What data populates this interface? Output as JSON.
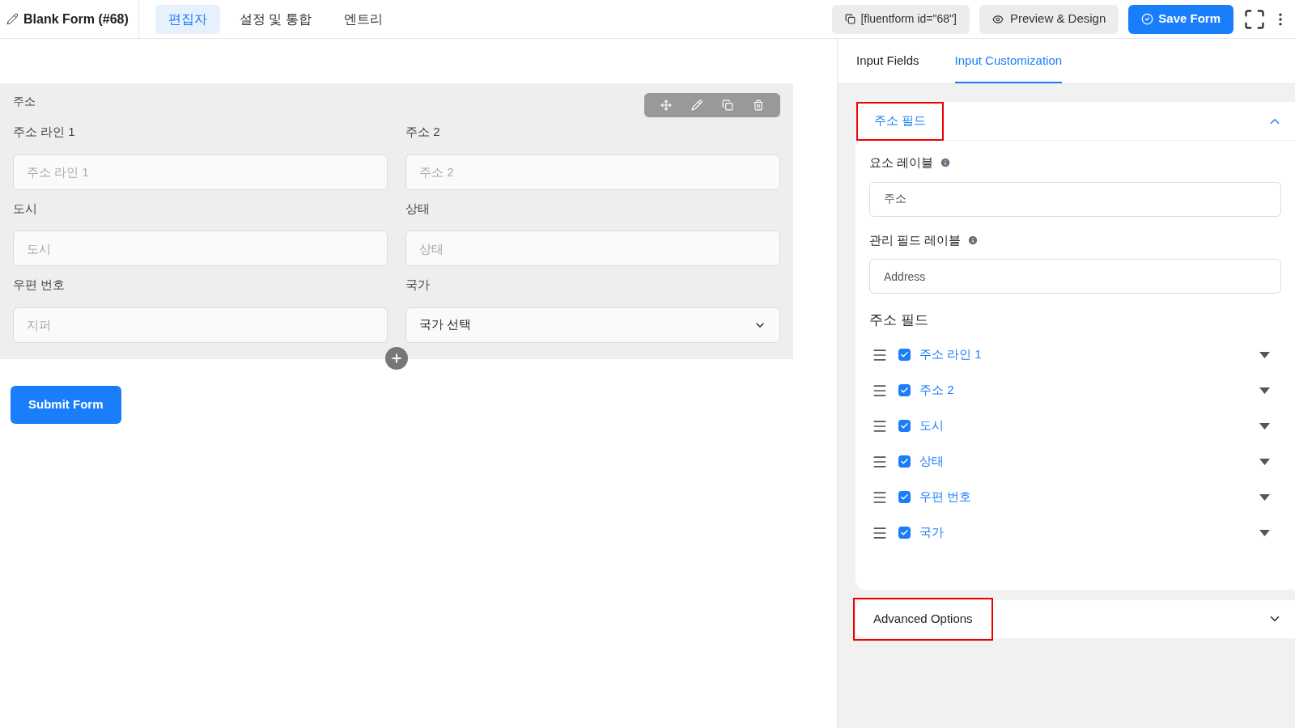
{
  "header": {
    "form_title": "Blank Form (#68)",
    "tabs": [
      {
        "label": "편집자",
        "selected": true
      },
      {
        "label": "설정 및 통합",
        "selected": false
      },
      {
        "label": "엔트리",
        "selected": false
      }
    ],
    "shortcode": "[fluentform id=\"68\"]",
    "preview_button": "Preview & Design",
    "save_button": "Save Form"
  },
  "form": {
    "group_label": "주소",
    "fields": [
      {
        "kind": "text",
        "label": "주소 라인 1",
        "placeholder": "주소 라인 1"
      },
      {
        "kind": "text",
        "label": "주소 2",
        "placeholder": "주소 2"
      },
      {
        "kind": "text",
        "label": "도시",
        "placeholder": "도시"
      },
      {
        "kind": "text",
        "label": "상태",
        "placeholder": "상태"
      },
      {
        "kind": "text",
        "label": "우편 번호",
        "placeholder": "지퍼"
      },
      {
        "kind": "select",
        "label": "국가",
        "value": "국가 선택"
      }
    ],
    "submit_button": "Submit Form"
  },
  "panel": {
    "tabs": [
      {
        "label": "Input Fields",
        "selected": false
      },
      {
        "label": "Input Customization",
        "selected": true
      }
    ],
    "section": {
      "title": "주소 필드",
      "expanded": true,
      "highlighted": true,
      "element_label": {
        "label": "요소 레이블",
        "value": "주소"
      },
      "admin_label": {
        "label": "관리 필드 레이블",
        "value": "Address"
      },
      "subfields_title": "주소 필드",
      "subfields": [
        {
          "label": "주소 라인 1",
          "checked": true
        },
        {
          "label": "주소 2",
          "checked": true
        },
        {
          "label": "도시",
          "checked": true
        },
        {
          "label": "상태",
          "checked": true
        },
        {
          "label": "우편 번호",
          "checked": true
        },
        {
          "label": "국가",
          "checked": true
        }
      ]
    },
    "advanced": {
      "title": "Advanced Options",
      "expanded": false,
      "highlighted": true
    }
  }
}
